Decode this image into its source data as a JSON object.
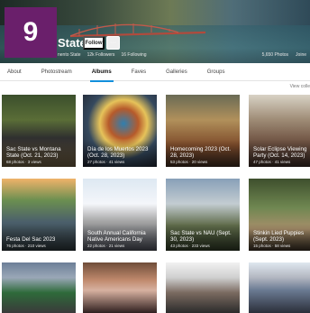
{
  "badge": {
    "number": "9"
  },
  "profile": {
    "title_fragment": "State",
    "follow_label": "Follow",
    "more_label": "···",
    "meta_left": [
      "nento State",
      "12k Followers",
      "16 Following"
    ],
    "meta_right": [
      "5,650 Photos",
      "Joine"
    ]
  },
  "tabs": [
    {
      "label": "About",
      "active": false
    },
    {
      "label": "Photostream",
      "active": false
    },
    {
      "label": "Albums",
      "active": true
    },
    {
      "label": "Faves",
      "active": false
    },
    {
      "label": "Galleries",
      "active": false
    },
    {
      "label": "Groups",
      "active": false
    }
  ],
  "view_all_label": "View colle",
  "albums": [
    {
      "title": "Sac State vs Montana State (Oct. 21, 2023)",
      "stats": "68 photos · 3 views"
    },
    {
      "title": "Día de los Muertos 2023 (Oct. 28, 2023)",
      "stats": "27 photos · 41 views"
    },
    {
      "title": "Homecoming 2023 (Oct. 28, 2023)",
      "stats": "53 photos · 20 views"
    },
    {
      "title": "Solar Eclipse Viewing Party (Oct. 14, 2023)",
      "stats": "47 photos · 41 views"
    },
    {
      "title": "Festa Del Sac 2023",
      "stats": "76 photos · 210 views"
    },
    {
      "title": "South Annual California Native Americans Day",
      "stats": "22 photos · 21 views"
    },
    {
      "title": "Sac State vs NAU (Sept. 30, 2023)",
      "stats": "43 photos · 233 views"
    },
    {
      "title": "Stinkin Lied Puppies (Sept. 2023)",
      "stats": "15 photos · 58 views"
    },
    {
      "title": "",
      "stats": ""
    },
    {
      "title": "",
      "stats": ""
    },
    {
      "title": "",
      "stats": ""
    },
    {
      "title": "",
      "stats": ""
    }
  ]
}
